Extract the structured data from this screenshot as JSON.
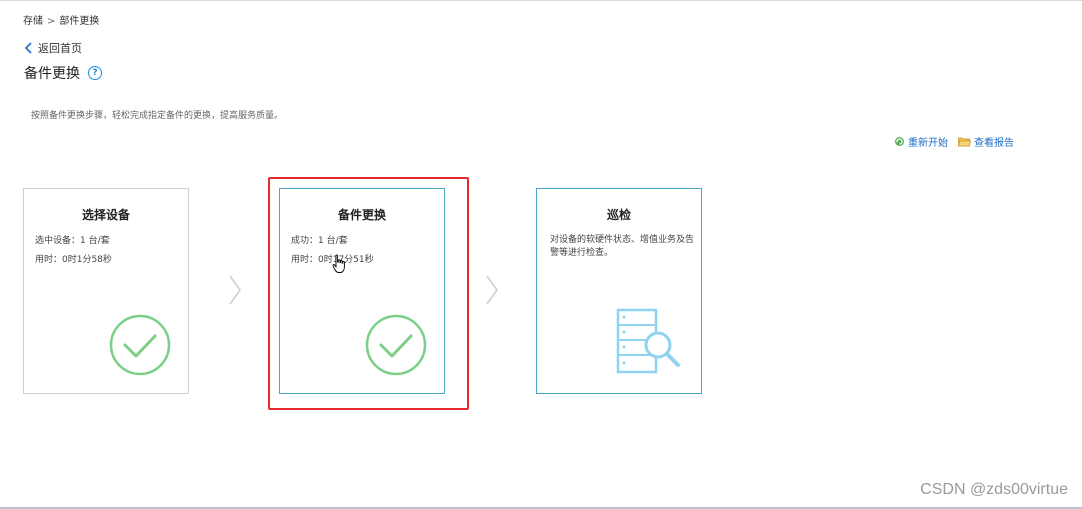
{
  "breadcrumb": {
    "root": "存储",
    "separator": ">",
    "current": "部件更换"
  },
  "back_label": "返回首页",
  "page_title": "备件更换",
  "help_glyph": "?",
  "description": "按照备件更换步骤，轻松完成指定备件的更换，提高服务质量。",
  "actions": {
    "restart": "重新开始",
    "report": "查看报告"
  },
  "cards": [
    {
      "title": "选择设备",
      "line1": "选中设备：1 台/套",
      "line2": "用时：0时1分58秒",
      "status": "done",
      "icon": "check-circle-icon"
    },
    {
      "title": "备件更换",
      "line1": "成功：1 台/套",
      "line2": "用时：0时17分51秒",
      "status": "done",
      "icon": "check-circle-icon"
    },
    {
      "title": "巡检",
      "desc": "对设备的软硬件状态、增值业务及告警等进行检查。",
      "status": "pending",
      "icon": "server-search-icon"
    }
  ],
  "colors": {
    "accent": "#1d6fc8",
    "check": "#7ccf86",
    "highlight": "#e42a2a",
    "card_border_active": "#4aa7c9",
    "server_icon": "#8fd3f0"
  },
  "watermark": "CSDN @zds00virtue"
}
